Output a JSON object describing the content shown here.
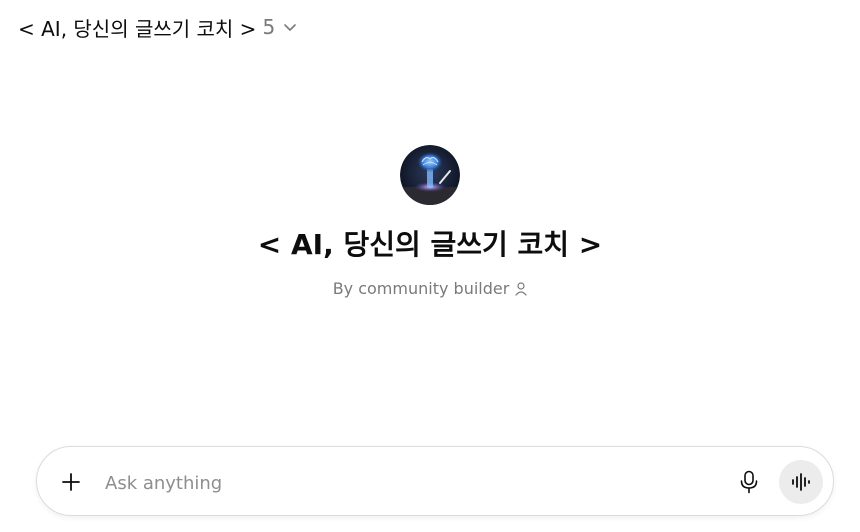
{
  "header": {
    "title": "< AI, 당신의 글쓰기 코치 >",
    "version": "5",
    "chevron_icon": "chevron-down-icon"
  },
  "gpt": {
    "name": "< AI, 당신의 글쓰기 코치 >",
    "byline": "By community builder",
    "byline_icon": "person-icon",
    "avatar_icon": "glowing-brain-avatar"
  },
  "composer": {
    "placeholder": "Ask anything",
    "value": "",
    "plus_icon": "plus-icon",
    "mic_icon": "microphone-icon",
    "voice_icon": "voice-waveform-icon"
  },
  "colors": {
    "text": "#0d0d0d",
    "muted": "#7a7a7a",
    "border": "#dcdcdc",
    "voice_button_bg": "#ececec"
  }
}
